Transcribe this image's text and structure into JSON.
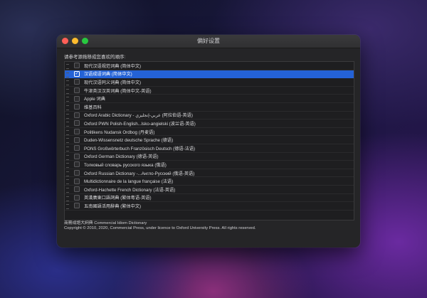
{
  "window": {
    "title": "偏好设置"
  },
  "instruction": "请参考源拖移成您喜欢的顺序:",
  "dictionaries": [
    {
      "label": "现代汉语规范词典 (简体中文)",
      "checked": false
    },
    {
      "label": "汉语成语词典 (简体中文)",
      "checked": true,
      "selected": true
    },
    {
      "label": "现代汉语同义词典 (简体中文)",
      "checked": false
    },
    {
      "label": "牛津英汉汉英词典 (简体中文-英语)",
      "checked": false
    },
    {
      "label": "Apple 词典",
      "checked": false
    },
    {
      "label": "维基百科",
      "checked": false
    },
    {
      "label": "Oxford Arabic Dictionary - عربي-إنجليزي (阿拉伯语-英语)",
      "checked": false
    },
    {
      "label": "Oxford PWN Polish-English...lsko-angielski (波兰语-英语)",
      "checked": false
    },
    {
      "label": "Politikens Nudansk Ordbog (丹麦语)",
      "checked": false
    },
    {
      "label": "Duden-Wissensnetz deutsche Sprache (德语)",
      "checked": false
    },
    {
      "label": "PONS Großwörterbuch Französisch Deutsch (德语-法语)",
      "checked": false
    },
    {
      "label": "Oxford German Dictionary (德语-英语)",
      "checked": false
    },
    {
      "label": "Толковый словарь русского языка (俄语)",
      "checked": false
    },
    {
      "label": "Oxford Russian Dictionary -...Англо-Русский (俄语-英语)",
      "checked": false
    },
    {
      "label": "Multidictionnaire de la langue française (法语)",
      "checked": false
    },
    {
      "label": "Oxford-Hachette French Dictionary (法语-英语)",
      "checked": false
    },
    {
      "label": "英漢廣東口語詞典 (繁体粤语-英语)",
      "checked": false
    },
    {
      "label": "五南國語活用辭典 (繁体中文)",
      "checked": false
    }
  ],
  "footer": {
    "line1": "商務成語大詞典 Commercial Idiom Dictionary",
    "line2": "Copyright © 2010, 2020, Commercial Press, under licence to Oxford University Press. All rights reserved."
  }
}
